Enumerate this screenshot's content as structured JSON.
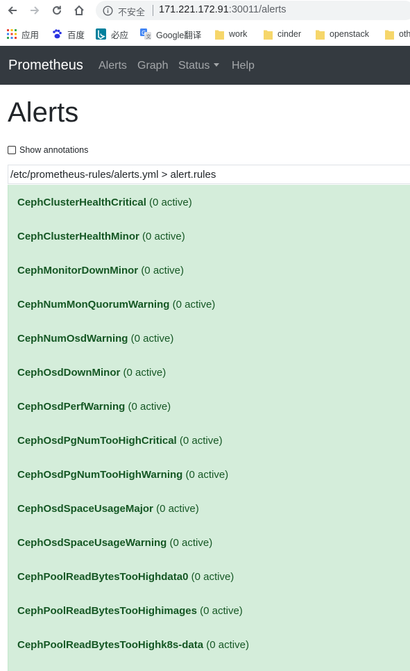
{
  "browser": {
    "address": {
      "insecure_label": "不安全",
      "url_host": "171.221.172.91",
      "url_rest": ":30011/alerts"
    },
    "bookmarks": [
      {
        "label": "应用",
        "icon": "apps-grid-icon"
      },
      {
        "label": "百度",
        "icon": "baidu-paw-icon"
      },
      {
        "label": "必应",
        "icon": "bing-icon"
      },
      {
        "label": "Google翻译",
        "icon": "google-translate-icon"
      },
      {
        "label": "work",
        "icon": "folder-icon"
      },
      {
        "label": "cinder",
        "icon": "folder-icon"
      },
      {
        "label": "openstack",
        "icon": "folder-icon"
      },
      {
        "label": "oth",
        "icon": "folder-icon"
      }
    ]
  },
  "navbar": {
    "brand": "Prometheus",
    "links": [
      "Alerts",
      "Graph",
      "Status",
      "Help"
    ],
    "bg_color": "#343a40"
  },
  "page": {
    "title": "Alerts",
    "show_annotations_label": "Show annotations",
    "show_annotations_checked": false,
    "group_header": "/etc/prometheus-rules/alerts.yml > alert.rules",
    "rule_bg_color": "#d4edda",
    "rules": [
      {
        "name": "CephClusterHealthCritical",
        "status": "(0 active)"
      },
      {
        "name": "CephClusterHealthMinor",
        "status": "(0 active)"
      },
      {
        "name": "CephMonitorDownMinor",
        "status": "(0 active)"
      },
      {
        "name": "CephNumMonQuorumWarning",
        "status": "(0 active)"
      },
      {
        "name": "CephNumOsdWarning",
        "status": "(0 active)"
      },
      {
        "name": "CephOsdDownMinor",
        "status": "(0 active)"
      },
      {
        "name": "CephOsdPerfWarning",
        "status": "(0 active)"
      },
      {
        "name": "CephOsdPgNumTooHighCritical",
        "status": "(0 active)"
      },
      {
        "name": "CephOsdPgNumTooHighWarning",
        "status": "(0 active)"
      },
      {
        "name": "CephOsdSpaceUsageMajor",
        "status": "(0 active)"
      },
      {
        "name": "CephOsdSpaceUsageWarning",
        "status": "(0 active)"
      },
      {
        "name": "CephPoolReadBytesTooHighdata0",
        "status": "(0 active)"
      },
      {
        "name": "CephPoolReadBytesTooHighimages",
        "status": "(0 active)"
      },
      {
        "name": "CephPoolReadBytesTooHighk8s-data",
        "status": "(0 active)"
      }
    ]
  }
}
